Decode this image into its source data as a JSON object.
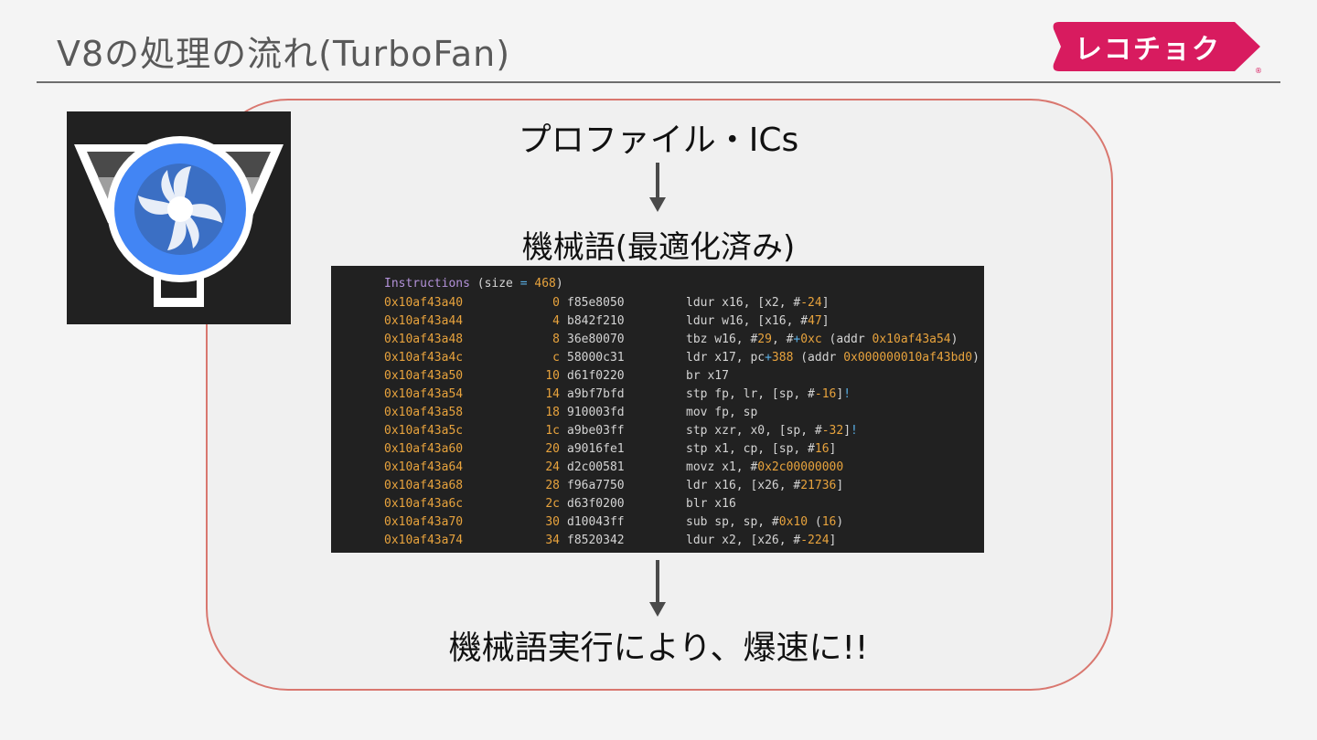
{
  "slide": {
    "title": "V8の処理の流れ(TurboFan)",
    "logo_text": "レコチョク",
    "logo_reg": "®"
  },
  "colors": {
    "logo_pink": "#d81b5f",
    "frame_border": "#d9776f",
    "fan_blue": "#4285f4",
    "code_orange": "#e8a33d",
    "code_purple": "#b392d9",
    "code_cyan": "#5ab0e6"
  },
  "icons": {
    "turbofan": "turbofan-logo-icon"
  },
  "flow": {
    "step1": "プロファイル・ICs",
    "step2": "機械語(最適化済み)",
    "step3": "機械語実行により、爆速に!!"
  },
  "code": {
    "header": {
      "keyword": "Instructions",
      "open": " (size ",
      "eq": "=",
      "size": " 468",
      "close": ")"
    },
    "rows": [
      {
        "addr": "0x10af43a40",
        "off": "0",
        "hex": "f85e8050",
        "ins": [
          [
            "ldur x16, [x2, #",
            ""
          ],
          [
            "-24",
            "n"
          ],
          [
            "]",
            ""
          ]
        ]
      },
      {
        "addr": "0x10af43a44",
        "off": "4",
        "hex": "b842f210",
        "ins": [
          [
            "ldur w16, [x16, #",
            ""
          ],
          [
            "47",
            "n"
          ],
          [
            "]",
            ""
          ]
        ]
      },
      {
        "addr": "0x10af43a48",
        "off": "8",
        "hex": "36e80070",
        "ins": [
          [
            "tbz w16, #",
            ""
          ],
          [
            "29",
            "n"
          ],
          [
            ", #",
            ""
          ],
          [
            "+",
            "c"
          ],
          [
            "0xc",
            "n"
          ],
          [
            " (addr ",
            ""
          ],
          [
            "0x10af43a54",
            "n"
          ],
          [
            ")",
            ""
          ]
        ]
      },
      {
        "addr": "0x10af43a4c",
        "off": "c",
        "hex": "58000c31",
        "ins": [
          [
            "ldr x17, pc",
            ""
          ],
          [
            "+",
            "c"
          ],
          [
            "388",
            "n"
          ],
          [
            " (addr ",
            ""
          ],
          [
            "0x000000010af43bd0",
            "n"
          ],
          [
            ")",
            ""
          ]
        ]
      },
      {
        "addr": "0x10af43a50",
        "off": "10",
        "hex": "d61f0220",
        "ins": [
          [
            "br x17",
            ""
          ]
        ]
      },
      {
        "addr": "0x10af43a54",
        "off": "14",
        "hex": "a9bf7bfd",
        "ins": [
          [
            "stp fp, lr, [sp, #",
            ""
          ],
          [
            "-16",
            "n"
          ],
          [
            "]",
            ""
          ],
          [
            "!",
            "c"
          ]
        ]
      },
      {
        "addr": "0x10af43a58",
        "off": "18",
        "hex": "910003fd",
        "ins": [
          [
            "mov fp, sp",
            ""
          ]
        ]
      },
      {
        "addr": "0x10af43a5c",
        "off": "1c",
        "hex": "a9be03ff",
        "ins": [
          [
            "stp xzr, x0, [sp, #",
            ""
          ],
          [
            "-32",
            "n"
          ],
          [
            "]",
            ""
          ],
          [
            "!",
            "c"
          ]
        ]
      },
      {
        "addr": "0x10af43a60",
        "off": "20",
        "hex": "a9016fe1",
        "ins": [
          [
            "stp x1, cp, [sp, #",
            ""
          ],
          [
            "16",
            "n"
          ],
          [
            "]",
            ""
          ]
        ]
      },
      {
        "addr": "0x10af43a64",
        "off": "24",
        "hex": "d2c00581",
        "ins": [
          [
            "movz x1, #",
            ""
          ],
          [
            "0x2c00000000",
            "n"
          ]
        ]
      },
      {
        "addr": "0x10af43a68",
        "off": "28",
        "hex": "f96a7750",
        "ins": [
          [
            "ldr x16, [x26, #",
            ""
          ],
          [
            "21736",
            "n"
          ],
          [
            "]",
            ""
          ]
        ]
      },
      {
        "addr": "0x10af43a6c",
        "off": "2c",
        "hex": "d63f0200",
        "ins": [
          [
            "blr x16",
            ""
          ]
        ]
      },
      {
        "addr": "0x10af43a70",
        "off": "30",
        "hex": "d10043ff",
        "ins": [
          [
            "sub sp, sp, #",
            ""
          ],
          [
            "0x10",
            "n"
          ],
          [
            " (",
            ""
          ],
          [
            "16",
            "n"
          ],
          [
            ")",
            ""
          ]
        ]
      },
      {
        "addr": "0x10af43a74",
        "off": "34",
        "hex": "f8520342",
        "ins": [
          [
            "ldur x2, [x26, #",
            ""
          ],
          [
            "-224",
            "n"
          ],
          [
            "]",
            ""
          ]
        ]
      }
    ]
  }
}
